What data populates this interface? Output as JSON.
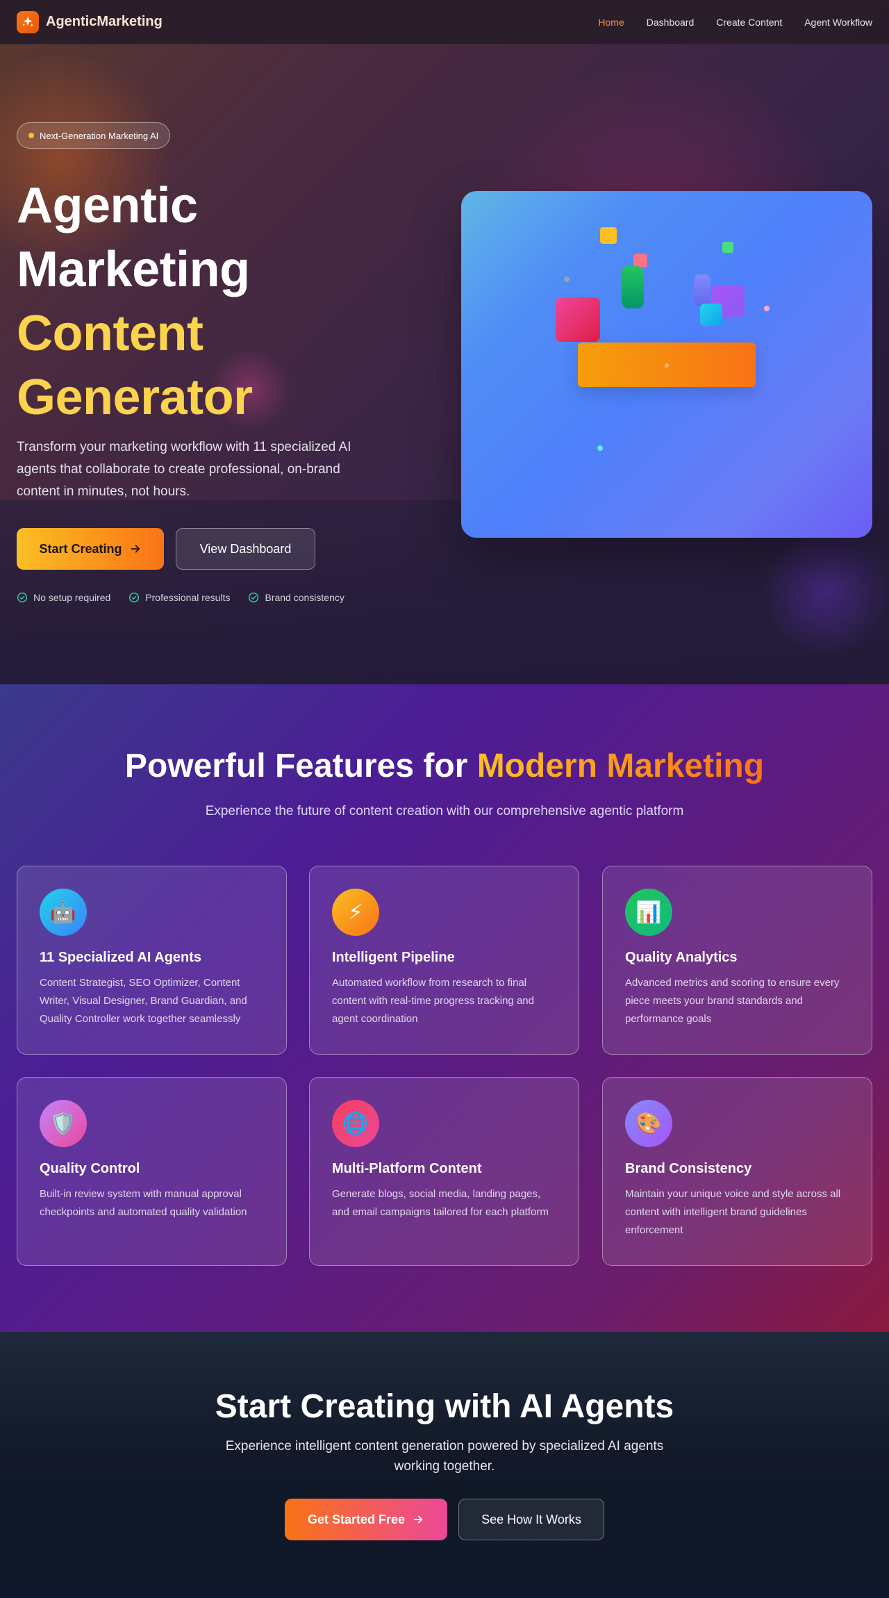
{
  "nav": {
    "brand": "AgenticMarketing",
    "links": [
      {
        "label": "Home",
        "active": true
      },
      {
        "label": "Dashboard",
        "active": false
      },
      {
        "label": "Create Content",
        "active": false
      },
      {
        "label": "Agent Workflow",
        "active": false
      }
    ]
  },
  "hero": {
    "badge": "Next-Generation Marketing AI",
    "title_lines": [
      "Agentic",
      "Marketing",
      "Content",
      "Generator"
    ],
    "subtitle": "Transform your marketing workflow with 11 specialized AI agents that collaborate to create professional, on-brand content in minutes, not hours.",
    "primary_button": "Start Creating",
    "secondary_button": "View Dashboard",
    "checks": [
      "No setup required",
      "Professional results",
      "Brand consistency"
    ]
  },
  "features": {
    "title_plain": "Powerful Features for ",
    "title_highlight": "Modern Marketing",
    "subtitle": "Experience the future of content creation with our comprehensive agentic platform",
    "cards": [
      {
        "icon": "robot-icon",
        "glyph": "🤖",
        "title": "11 Specialized AI Agents",
        "desc": "Content Strategist, SEO Optimizer, Content Writer, Visual Designer, Brand Guardian, and Quality Controller work together seamlessly"
      },
      {
        "icon": "lightning-icon",
        "glyph": "⚡",
        "title": "Intelligent Pipeline",
        "desc": "Automated workflow from research to final content with real-time progress tracking and agent coordination"
      },
      {
        "icon": "bar-chart-icon",
        "glyph": "📊",
        "title": "Quality Analytics",
        "desc": "Advanced metrics and scoring to ensure every piece meets your brand standards and performance goals"
      },
      {
        "icon": "shield-icon",
        "glyph": "🛡️",
        "title": "Quality Control",
        "desc": "Built-in review system with manual approval checkpoints and automated quality validation"
      },
      {
        "icon": "globe-icon",
        "glyph": "🌐",
        "title": "Multi-Platform Content",
        "desc": "Generate blogs, social media, landing pages, and email campaigns tailored for each platform"
      },
      {
        "icon": "palette-icon",
        "glyph": "🎨",
        "title": "Brand Consistency",
        "desc": "Maintain your unique voice and style across all content with intelligent brand guidelines enforcement"
      }
    ]
  },
  "cta": {
    "title": "Start Creating with AI Agents",
    "subtitle": "Experience intelligent content generation powered by specialized AI agents working together.",
    "primary_button": "Get Started Free",
    "secondary_button": "See How It Works"
  },
  "colors": {
    "accent_orange": "#f97316",
    "accent_yellow": "#fcd34d",
    "check_green": "#34d399"
  }
}
